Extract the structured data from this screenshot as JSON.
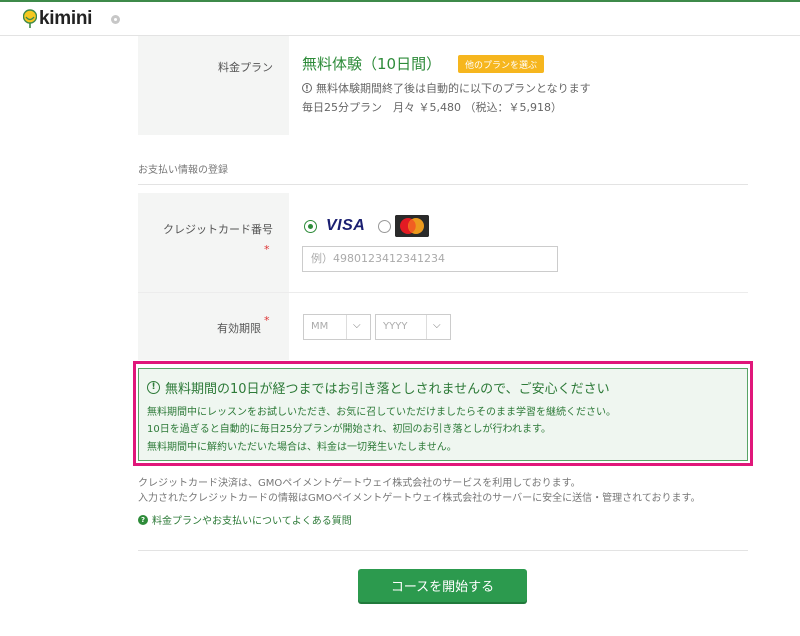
{
  "header": {
    "logo_text": "kimini",
    "colors": {
      "brand_green": "#3d8a4a",
      "logo_yellow": "#f6c821"
    }
  },
  "plan": {
    "label": "料金プラン",
    "name": "無料体験（10日間）",
    "change_button": "他のプランを選ぶ",
    "note": "無料体験期間終了後は自動的に以下のプランとなります",
    "detail": "毎日25分プラン　月々 ￥5,480 （税込：￥5,918）"
  },
  "payment": {
    "section_title": "お支払い情報の登録",
    "card_number_label": "クレジットカード番号",
    "required_mark": "*",
    "brands": [
      {
        "name": "VISA",
        "selected": true
      },
      {
        "name": "MasterCard",
        "selected": false
      }
    ],
    "card_placeholder": "例）4980123412341234",
    "expiry_label": "有効期限",
    "month_placeholder": "MM",
    "year_placeholder": "YYYY"
  },
  "notice": {
    "title": "無料期間の10日が経つまではお引き落としされませんので、ご安心ください",
    "lines": [
      "無料期間中にレッスンをお試しいただき、お気に召していただけましたらそのまま学習を継続ください。",
      "10日を過ぎると自動的に毎日25分プランが開始され、初回のお引き落としが行われます。",
      "無料期間中に解約いただいた場合は、料金は一切発生いたしません。"
    ],
    "highlight_color": "#e0177a"
  },
  "footnotes": [
    "クレジットカード決済は、GMOペイメントゲートウェイ株式会社のサービスを利用しております。",
    "入力されたクレジットカードの情報はGMOペイメントゲートウェイ株式会社のサーバーに安全に送信・管理されております。"
  ],
  "faq_link": "料金プランやお支払いについてよくある質問",
  "start_button": "コースを開始する"
}
